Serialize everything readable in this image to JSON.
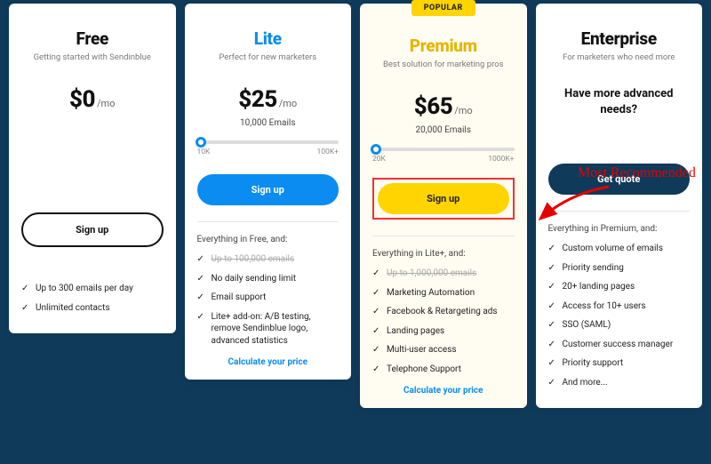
{
  "popular_badge": "POPULAR",
  "annotation": {
    "text": "Most Recommended"
  },
  "plans": {
    "free": {
      "title": "Free",
      "subtitle": "Getting started with Sendinblue",
      "price": "$0",
      "per": "/mo",
      "cta": "Sign up",
      "features": [
        "Up to 300 emails per day",
        "Unlimited contacts"
      ]
    },
    "lite": {
      "title": "Lite",
      "subtitle": "Perfect for new marketers",
      "price": "$25",
      "per": "/mo",
      "emails": "10,000 Emails",
      "slider": {
        "min": "10K",
        "max": "100K+"
      },
      "cta": "Sign up",
      "section_head": "Everything in Free, and:",
      "struck": "Up to 100,000 emails",
      "features": [
        "No daily sending limit",
        "Email support",
        "Lite+ add-on: A/B testing, remove Sendinblue logo, advanced statistics"
      ],
      "calc": "Calculate your price"
    },
    "premium": {
      "title": "Premium",
      "subtitle": "Best solution for marketing pros",
      "price": "$65",
      "per": "/mo",
      "emails": "20,000 Emails",
      "slider": {
        "min": "20K",
        "max": "1000K+"
      },
      "cta": "Sign up",
      "section_head": "Everything in Lite+, and:",
      "struck": "Up to 1,000,000 emails",
      "features": [
        "Marketing Automation",
        "Facebook & Retargeting ads",
        "Landing pages",
        "Multi-user access",
        "Telephone Support"
      ],
      "calc": "Calculate your price"
    },
    "enterprise": {
      "title": "Enterprise",
      "subtitle": "For marketers who need more",
      "question": "Have more advanced needs?",
      "cta": "Get quote",
      "section_head": "Everything in Premium, and:",
      "features": [
        "Custom volume of emails",
        "Priority sending",
        "20+ landing pages",
        "Access for 10+ users",
        "SSO (SAML)",
        "Customer success manager",
        "Priority support",
        "And more..."
      ]
    }
  }
}
